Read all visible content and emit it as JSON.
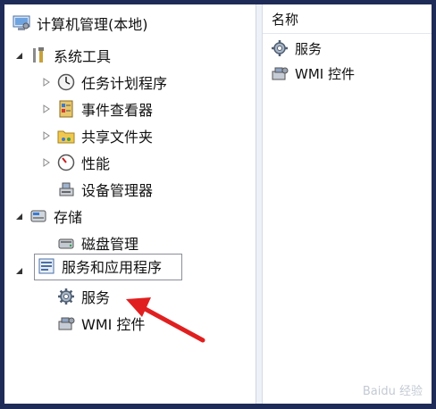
{
  "tree": {
    "root": "计算机管理(本地)",
    "system_tools": "系统工具",
    "task_scheduler": "任务计划程序",
    "event_viewer": "事件查看器",
    "shared_folders": "共享文件夹",
    "performance": "性能",
    "device_manager": "设备管理器",
    "storage": "存储",
    "disk_management": "磁盘管理",
    "services_apps": "服务和应用程序",
    "services": "服务",
    "wmi_control": "WMI 控件"
  },
  "list": {
    "column_header": "名称",
    "items": [
      "服务",
      "WMI 控件"
    ]
  },
  "watermark": "Baidu 经验",
  "colors": {
    "frame": "#1f2b57",
    "arrow": "#e02020",
    "selection_border": "#8a8f99"
  }
}
